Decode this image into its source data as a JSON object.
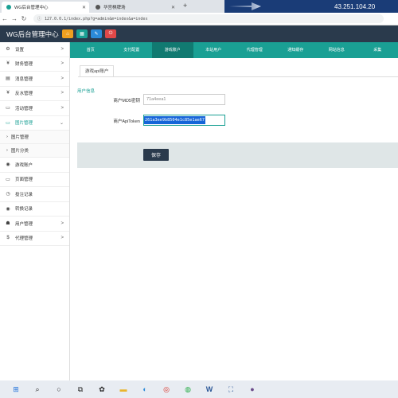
{
  "browser": {
    "tabs": [
      {
        "title": "WG后台管理中心",
        "favicon_color": "#1aa094"
      },
      {
        "title": "华宫棋牌场",
        "favicon_color": "#555555"
      }
    ],
    "new_tab": "+",
    "ip_banner": "43.251.104.20",
    "url": "127.0.0.1/index.php?g=admin&m=index&a=index",
    "nav": {
      "back": "←",
      "forward": "→",
      "reload": "↻"
    }
  },
  "header": {
    "title": "WG后台管理中心",
    "buttons": [
      {
        "icon": "home-icon",
        "glyph": "⌂",
        "color": "#f0a020"
      },
      {
        "icon": "grid-icon",
        "glyph": "▦",
        "color": "#1aa094"
      },
      {
        "icon": "pencil-icon",
        "glyph": "✎",
        "color": "#2b8ad8"
      },
      {
        "icon": "power-icon",
        "glyph": "⏻",
        "color": "#e04848"
      }
    ]
  },
  "sidebar": {
    "items": [
      {
        "label": "设置",
        "icon": "gear-icon",
        "glyph": "⚙",
        "chevron": ">"
      },
      {
        "label": "财务管理",
        "icon": "yen-icon",
        "glyph": "¥",
        "chevron": ">"
      },
      {
        "label": "消息管理",
        "icon": "book-icon",
        "glyph": "▤",
        "chevron": ">"
      },
      {
        "label": "反水管理",
        "icon": "yen-icon",
        "glyph": "¥",
        "chevron": ">"
      },
      {
        "label": "活动管理",
        "icon": "doc-icon",
        "glyph": "▭",
        "chevron": ">"
      },
      {
        "label": "图片管理",
        "icon": "monitor-icon",
        "glyph": "▭",
        "chevron": "⌄",
        "active": true
      }
    ],
    "subitems": [
      {
        "label": "图片管理"
      },
      {
        "label": "图片分类"
      }
    ],
    "items_after": [
      {
        "label": "游戏账户",
        "icon": "gamepad-icon",
        "glyph": "◉"
      },
      {
        "label": "页面管理",
        "icon": "monitor-icon",
        "glyph": "▭"
      },
      {
        "label": "投注记录",
        "icon": "clock-icon",
        "glyph": "◷"
      },
      {
        "label": "转换记录",
        "icon": "gamepad-icon",
        "glyph": "◉"
      },
      {
        "label": "用户管理",
        "icon": "users-icon",
        "glyph": "☗",
        "chevron": ">"
      },
      {
        "label": "代理管理",
        "icon": "dollar-icon",
        "glyph": "$",
        "chevron": ">"
      }
    ]
  },
  "topnav": {
    "items": [
      "首页",
      "支付配置",
      "游戏账户",
      "本站用户",
      "代理管理",
      "通知缓存",
      "网站信息",
      "采集"
    ],
    "active_index": 2
  },
  "page": {
    "tab_label": "游戏api账户",
    "section_title": "用户信息",
    "fields": [
      {
        "label": "商户MD5密钥",
        "value": "71a4eea1"
      },
      {
        "label": "商户ApiToken",
        "value": "261a3ee9b8504e1c85e1ae67"
      }
    ],
    "save_label": "保存"
  },
  "taskbar": {
    "icons": [
      {
        "name": "windows-start-icon",
        "glyph": "⊞",
        "color": "#1e6fd9"
      },
      {
        "name": "search-icon",
        "glyph": "⌕",
        "color": "#222"
      },
      {
        "name": "cortana-icon",
        "glyph": "○",
        "color": "#222"
      },
      {
        "name": "task-view-icon",
        "glyph": "⧉",
        "color": "#222"
      },
      {
        "name": "app-icon",
        "glyph": "✿",
        "color": "#222"
      },
      {
        "name": "file-explorer-icon",
        "glyph": "▬",
        "color": "#e9b52c"
      },
      {
        "name": "edge-icon",
        "glyph": "◐",
        "color": "#2b8ad8"
      },
      {
        "name": "chrome-icon",
        "glyph": "◎",
        "color": "#d93025"
      },
      {
        "name": "wechat-icon",
        "glyph": "◍",
        "color": "#2bae4a"
      },
      {
        "name": "word-icon",
        "glyph": "W",
        "color": "#2b5797"
      },
      {
        "name": "network-icon",
        "glyph": "⛶",
        "color": "#2b5797"
      },
      {
        "name": "app-icon-2",
        "glyph": "●",
        "color": "#6a4a8a"
      }
    ]
  }
}
